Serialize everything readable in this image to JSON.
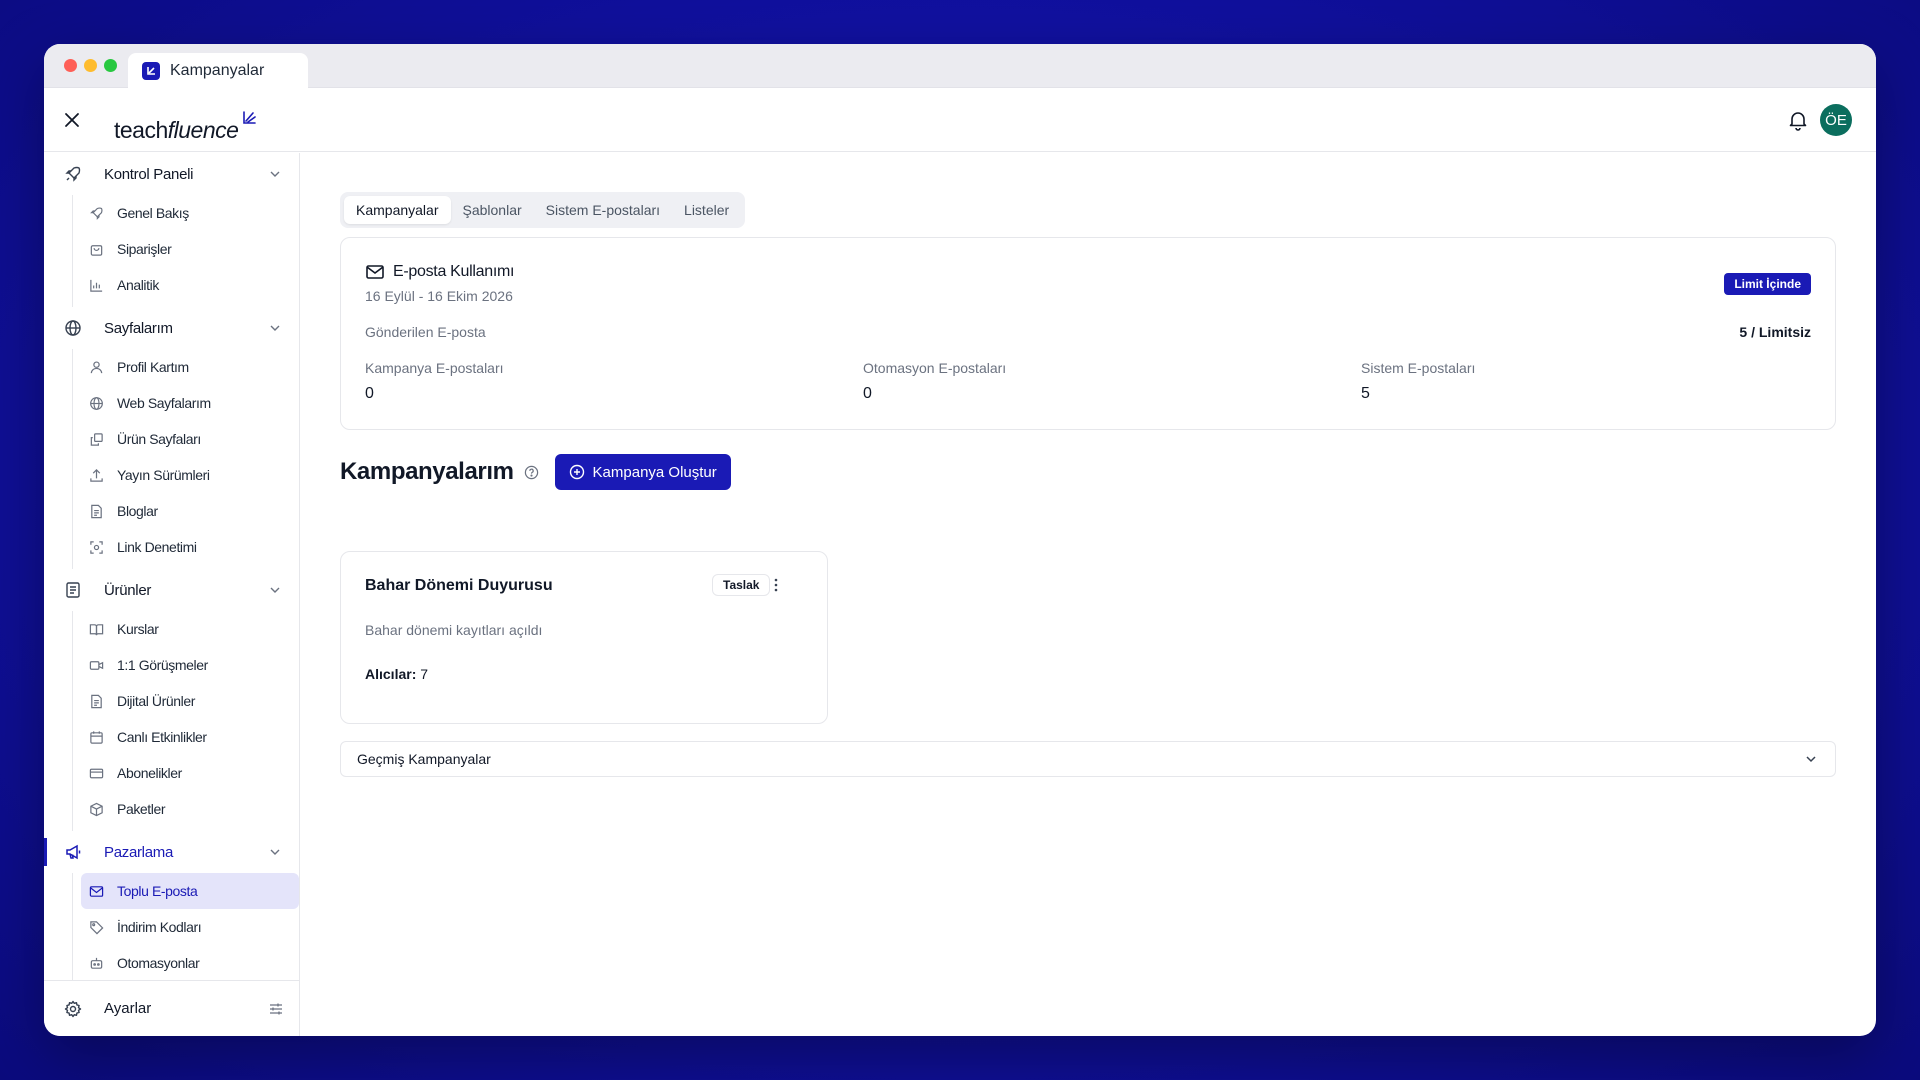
{
  "browser_tab": {
    "title": "Kampanyalar"
  },
  "header": {
    "logo": {
      "part1": "teach",
      "part2": "fluence"
    },
    "avatar_initials": "ÖE"
  },
  "sidebar": {
    "sections": [
      {
        "label": "Kontrol Paneli",
        "icon": "rocket-icon",
        "items": [
          {
            "label": "Genel Bakış",
            "icon": "rocket-icon"
          },
          {
            "label": "Siparişler",
            "icon": "shopping-bag-icon"
          },
          {
            "label": "Analitik",
            "icon": "bar-chart-icon"
          }
        ]
      },
      {
        "label": "Sayfalarım",
        "icon": "globe-icon",
        "items": [
          {
            "label": "Profil Kartım",
            "icon": "user-icon"
          },
          {
            "label": "Web Sayfalarım",
            "icon": "globe-icon"
          },
          {
            "label": "Ürün Sayfaları",
            "icon": "copy-icon"
          },
          {
            "label": "Yayın Sürümleri",
            "icon": "upload-icon"
          },
          {
            "label": "Bloglar",
            "icon": "document-icon"
          },
          {
            "label": "Link Denetimi",
            "icon": "scan-icon"
          }
        ]
      },
      {
        "label": "Ürünler",
        "icon": "file-list-icon",
        "items": [
          {
            "label": "Kurslar",
            "icon": "book-open-icon"
          },
          {
            "label": "1:1 Görüşmeler",
            "icon": "video-icon"
          },
          {
            "label": "Dijital Ürünler",
            "icon": "document-icon"
          },
          {
            "label": "Canlı Etkinlikler",
            "icon": "calendar-icon"
          },
          {
            "label": "Abonelikler",
            "icon": "credit-card-icon"
          },
          {
            "label": "Paketler",
            "icon": "package-icon"
          }
        ]
      },
      {
        "label": "Pazarlama",
        "icon": "megaphone-icon",
        "active": true,
        "items": [
          {
            "label": "Toplu E-posta",
            "icon": "mail-icon",
            "active": true
          },
          {
            "label": "İndirim Kodları",
            "icon": "tag-icon"
          },
          {
            "label": "Otomasyonlar",
            "icon": "robot-icon"
          }
        ]
      }
    ],
    "footer": {
      "label": "Ayarlar",
      "icon": "gear-icon"
    }
  },
  "main": {
    "tabs": [
      {
        "label": "Kampanyalar",
        "active": true
      },
      {
        "label": "Şablonlar"
      },
      {
        "label": "Sistem E-postaları"
      },
      {
        "label": "Listeler"
      }
    ],
    "usage": {
      "title": "E-posta Kullanımı",
      "date_range": "16 Eylül - 16 Ekim 2026",
      "badge": "Limit İçinde",
      "sent_label": "Gönderilen E-posta",
      "sent_value": "5 / Limitsiz",
      "stats": [
        {
          "label": "Kampanya E-postaları",
          "value": "0"
        },
        {
          "label": "Otomasyon E-postaları",
          "value": "0"
        },
        {
          "label": "Sistem E-postaları",
          "value": "5"
        }
      ]
    },
    "heading": "Kampanyalarım",
    "create_button": "Kampanya Oluştur",
    "campaign": {
      "title": "Bahar Dönemi Duyurusu",
      "status": "Taslak",
      "description": "Bahar dönemi kayıtları açıldı",
      "recipients_label": "Alıcılar:",
      "recipients_value": "7"
    },
    "past_campaigns": "Geçmiş Kampanyalar"
  },
  "colors": {
    "accent": "#1a1ab5",
    "avatar": "#0b6e5e",
    "active_bg": "#e4e4fa"
  }
}
